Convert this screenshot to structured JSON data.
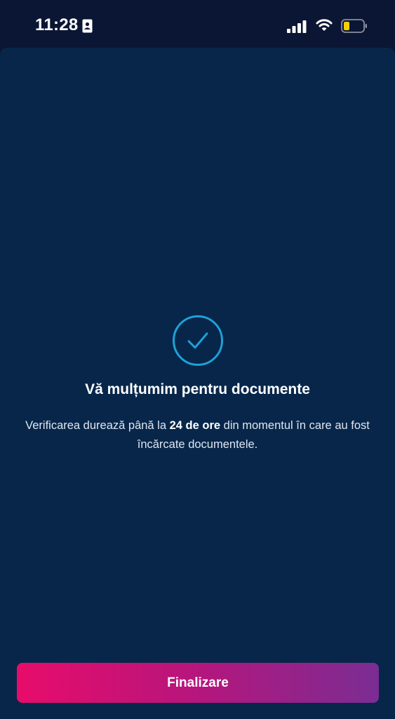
{
  "status_bar": {
    "time": "11:28",
    "icons": [
      "id-card-icon",
      "cellular-signal-icon",
      "wifi-icon",
      "battery-icon"
    ],
    "battery_level": 0.25,
    "battery_color": "#f5d000"
  },
  "confirmation": {
    "icon": "checkmark-circle-icon",
    "icon_color": "#1ea0d6",
    "title": "Vă mulțumim pentru documente",
    "message_part1": "Verificarea durează până la ",
    "message_bold": "24 de ore",
    "message_part2": " din momentul în care au fost încărcate documentele."
  },
  "actions": {
    "finish_label": "Finalizare",
    "gradient_start": "#e80c6a",
    "gradient_end": "#7a2d93"
  }
}
